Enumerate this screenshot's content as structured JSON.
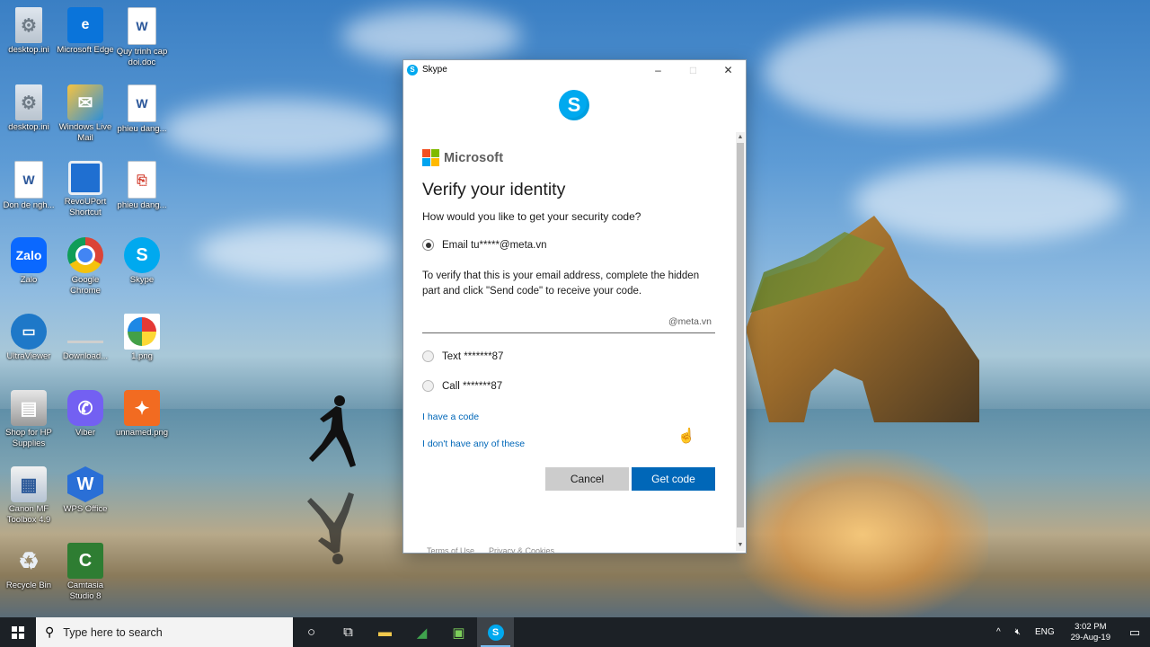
{
  "desktop": {
    "icons": [
      {
        "label": "desktop.ini",
        "icon": "settings-file-icon"
      },
      {
        "label": "Microsoft Edge",
        "icon": "edge-icon"
      },
      {
        "label": "Quy trinh cap doi.doc",
        "icon": "word-doc-icon"
      },
      {
        "label": "desktop.ini",
        "icon": "settings-file-icon"
      },
      {
        "label": "Windows Live Mail",
        "icon": "mail-icon"
      },
      {
        "label": "phieu dang...",
        "icon": "word-doc-icon"
      },
      {
        "label": "Don de ngh...",
        "icon": "word-doc-icon"
      },
      {
        "label": "RevoUPort Shortcut",
        "icon": "shortcut-icon"
      },
      {
        "label": "phieu dang...",
        "icon": "pdf-icon"
      },
      {
        "label": "Zalo",
        "icon": "zalo-icon"
      },
      {
        "label": "Google Chrome",
        "icon": "chrome-icon"
      },
      {
        "label": "Skype",
        "icon": "skype-icon"
      },
      {
        "label": "UltraViewer",
        "icon": "ultraviewer-icon"
      },
      {
        "label": "Download...",
        "icon": "download-icon"
      },
      {
        "label": "1.png",
        "icon": "image-icon"
      },
      {
        "label": "Shop for HP Supplies",
        "icon": "printer-icon"
      },
      {
        "label": "Viber",
        "icon": "viber-icon"
      },
      {
        "label": "unnamed.png",
        "icon": "image-icon"
      },
      {
        "label": "Canon MF Toolbox 4.9",
        "icon": "scanner-icon"
      },
      {
        "label": "WPS Office",
        "icon": "wps-icon"
      },
      {
        "label": "Recycle Bin",
        "icon": "recycle-bin-icon"
      },
      {
        "label": "Camtasia Studio 8",
        "icon": "camtasia-icon"
      }
    ]
  },
  "window": {
    "title": "Skype",
    "minimize": "–",
    "maximize": "□",
    "close": "✕",
    "brand": "Microsoft",
    "heading": "Verify your identity",
    "question": "How would you like to get your security code?",
    "options": [
      {
        "label": "Email tu*****@meta.vn",
        "checked": true
      },
      {
        "label": "Text *******87",
        "checked": false
      },
      {
        "label": "Call *******87",
        "checked": false
      }
    ],
    "description": "To verify that this is your email address, complete the hidden part and click \"Send code\" to receive your code.",
    "email_value": "",
    "email_suffix": "@meta.vn",
    "link_have_code": "I have a code",
    "link_none": "I don't have any of these",
    "cancel_label": "Cancel",
    "get_code_label": "Get code",
    "footer": [
      "Terms of Use",
      "Privacy & Cookies"
    ]
  },
  "taskbar": {
    "search_placeholder": "Type here to search",
    "language": "ENG",
    "time": "3:02 PM",
    "date": "29-Aug-19"
  },
  "colors": {
    "accent": "#0067b8",
    "skype": "#00a9ef",
    "ms_red": "#f25022",
    "ms_green": "#7fba00",
    "ms_blue": "#00a4ef",
    "ms_yellow": "#ffb900"
  }
}
